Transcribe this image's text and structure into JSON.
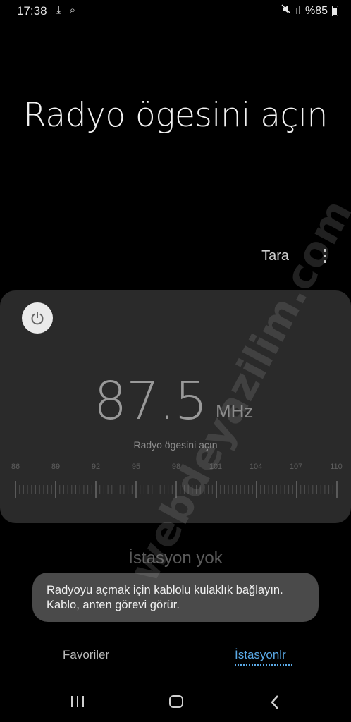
{
  "status_bar": {
    "time": "17:38",
    "left_icons": "⤓ ⌕",
    "signal": "ıl",
    "battery": "%85"
  },
  "title": "Radyo ögesini açın",
  "toolbar": {
    "scan_label": "Tara",
    "more_icon": "more-vert-icon"
  },
  "player": {
    "frequency": "87.5",
    "unit": "MHz",
    "hint": "Radyo ögesini açın",
    "scale_labels": [
      "86",
      "89",
      "92",
      "95",
      "98",
      "101",
      "104",
      "107",
      "110"
    ]
  },
  "stations": {
    "empty_text": "İstasyon yok"
  },
  "toast": {
    "message": "Radyoyu açmak için kablolu kulaklık bağlayın. Kablo, anten görevi görür."
  },
  "tabs": [
    {
      "label": "Favoriler",
      "active": false
    },
    {
      "label": "İstasyonlr",
      "active": true
    }
  ],
  "watermark": "webdeyazilim.com",
  "colors": {
    "accent": "#5aa9e6",
    "card": "#2a2a2a",
    "toast": "#4a4a4a"
  }
}
